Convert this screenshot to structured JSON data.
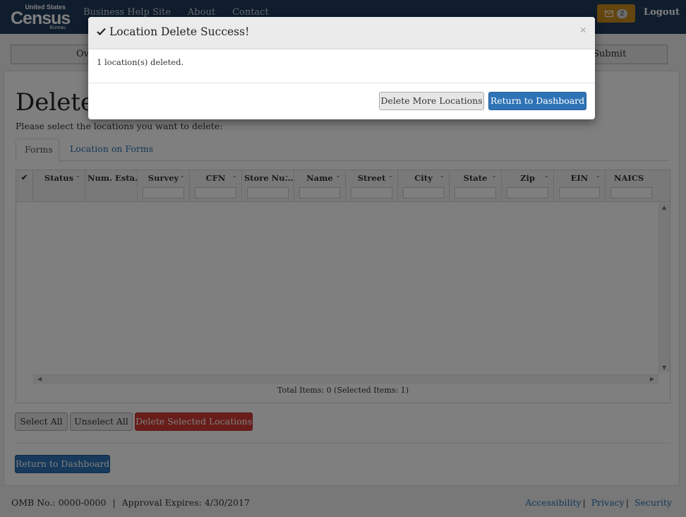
{
  "navbar": {
    "logo": {
      "line1": "United States",
      "line2": "Census",
      "line3": "Bureau"
    },
    "links": [
      "Business Help Site",
      "About",
      "Contact"
    ],
    "message_count": "2",
    "logout": "Logout"
  },
  "steps": {
    "left_text": "Ove",
    "right_text": "Submit"
  },
  "page": {
    "title": "Delete L",
    "instructions": "Please select the locations you want to delete:",
    "tabs": [
      "Forms",
      "Location on Forms"
    ]
  },
  "grid": {
    "columns": [
      "✔",
      "Status",
      "Num. Esta...",
      "Survey",
      "CFN",
      "Store Nu...",
      "Name",
      "Street",
      "City",
      "State",
      "Zip",
      "EIN",
      "NAICS"
    ],
    "footer": "Total Items: 0 (Selected Items: 1)"
  },
  "buttons": {
    "select_all": "Select All",
    "unselect_all": "Unselect All",
    "delete_selected": "Delete Selected Locations",
    "return_dashboard": "Return to Dashboard"
  },
  "footer": {
    "omb": "OMB No.: 0000-0000",
    "separator": "|",
    "approval": "Approval Expires: 4/30/2017",
    "links": [
      "Accessibility",
      "Privacy",
      "Security"
    ]
  },
  "modal": {
    "title": "Location Delete Success!",
    "close": "×",
    "body": "1 location(s) deleted.",
    "delete_more": "Delete More Locations",
    "return_dashboard": "Return to Dashboard"
  },
  "colors": {
    "navbar": "#1f3a5a",
    "primary": "#2f73b7",
    "danger": "#d33a35",
    "warning": "#c98a1e"
  }
}
